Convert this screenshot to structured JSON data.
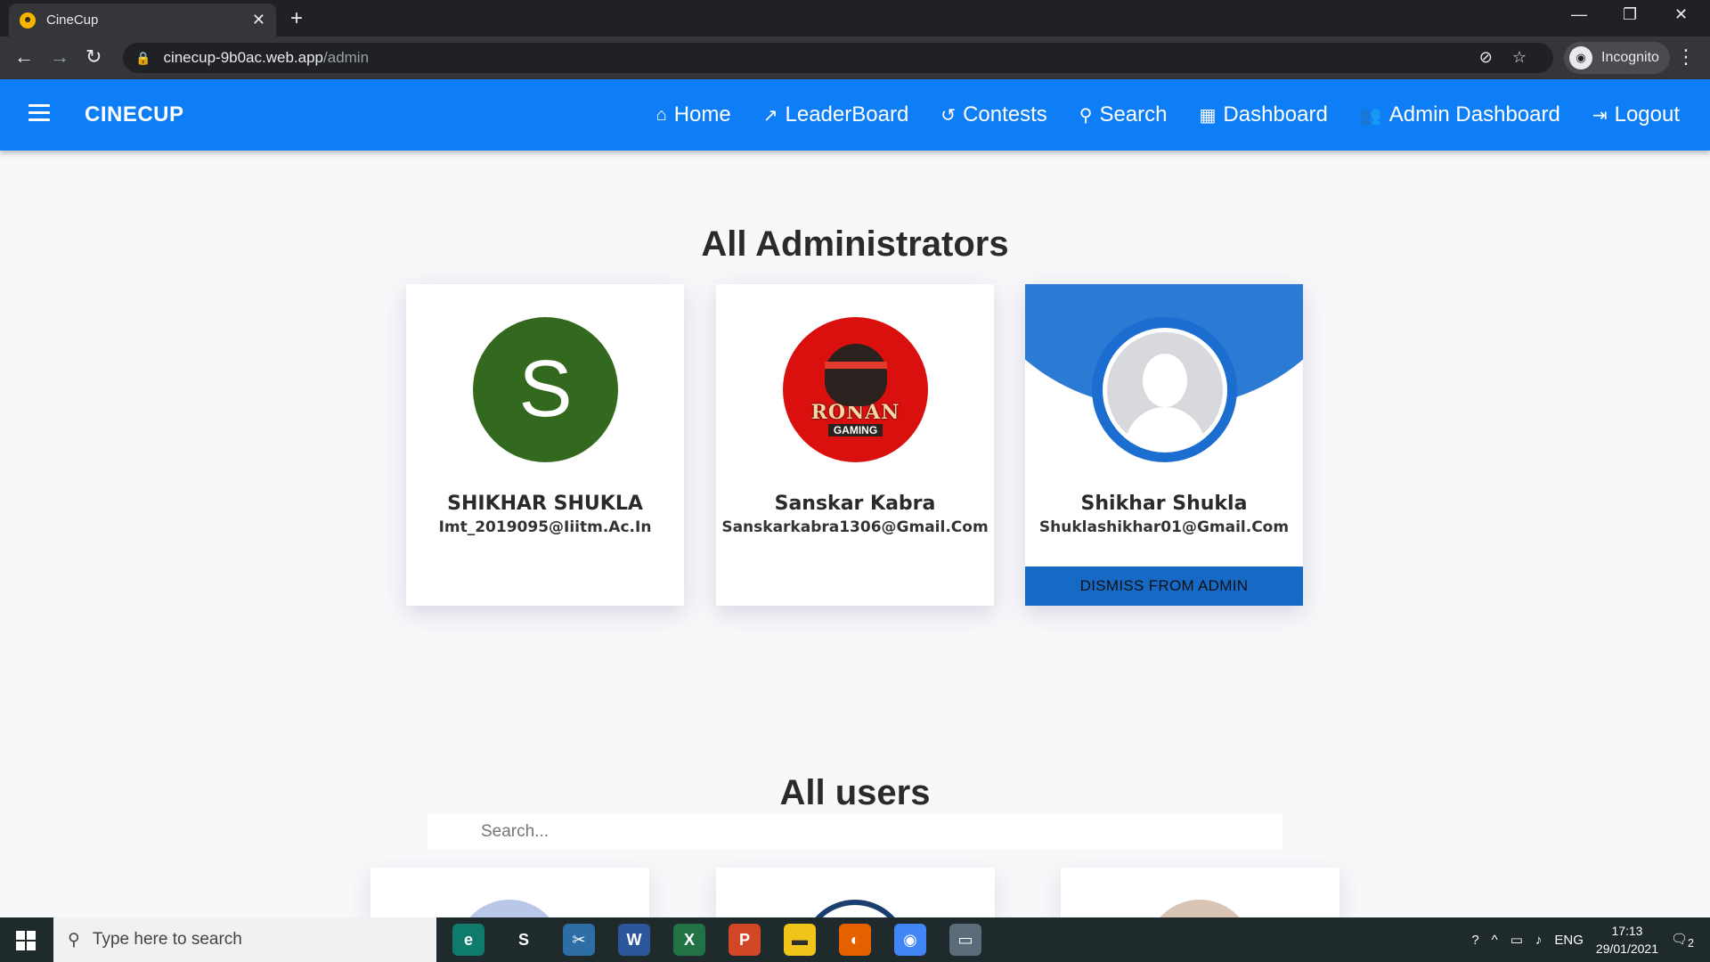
{
  "browser": {
    "tab_title": "CineCup",
    "url_host": "cinecup-9b0ac.web.app",
    "url_path": "/admin",
    "profile_label": "Incognito"
  },
  "app": {
    "brand": "CINECUP",
    "nav": [
      {
        "label": "Home",
        "icon": "home-icon"
      },
      {
        "label": "LeaderBoard",
        "icon": "trending-icon"
      },
      {
        "label": "Contests",
        "icon": "history-icon"
      },
      {
        "label": "Search",
        "icon": "search-icon"
      },
      {
        "label": "Dashboard",
        "icon": "dashboard-icon"
      },
      {
        "label": "Admin Dashboard",
        "icon": "people-icon"
      },
      {
        "label": "Logout",
        "icon": "logout-icon"
      }
    ],
    "colors": {
      "primary": "#0d7ef6",
      "admin_accent": "#2b7ad3"
    }
  },
  "admins_section": {
    "title": "All Administrators",
    "admins": [
      {
        "name": "SHIKHAR SHUKLA",
        "email": "Imt_2019095@Iiitm.Ac.In",
        "avatar_letter": "S"
      },
      {
        "name": "Sanskar Kabra",
        "email": "Sanskarkabra1306@Gmail.Com",
        "avatar_text": "RONAN",
        "avatar_subtext": "GAMING"
      },
      {
        "name": "Shikhar Shukla",
        "email": "Shuklashikhar01@Gmail.Com",
        "action_label": "DISMISS FROM ADMIN"
      }
    ]
  },
  "users_section": {
    "title": "All users",
    "search_placeholder": "Search..."
  },
  "taskbar": {
    "search_placeholder": "Type here to search",
    "language": "ENG",
    "time": "17:13",
    "date": "29/01/2021",
    "notification_count": "2"
  }
}
